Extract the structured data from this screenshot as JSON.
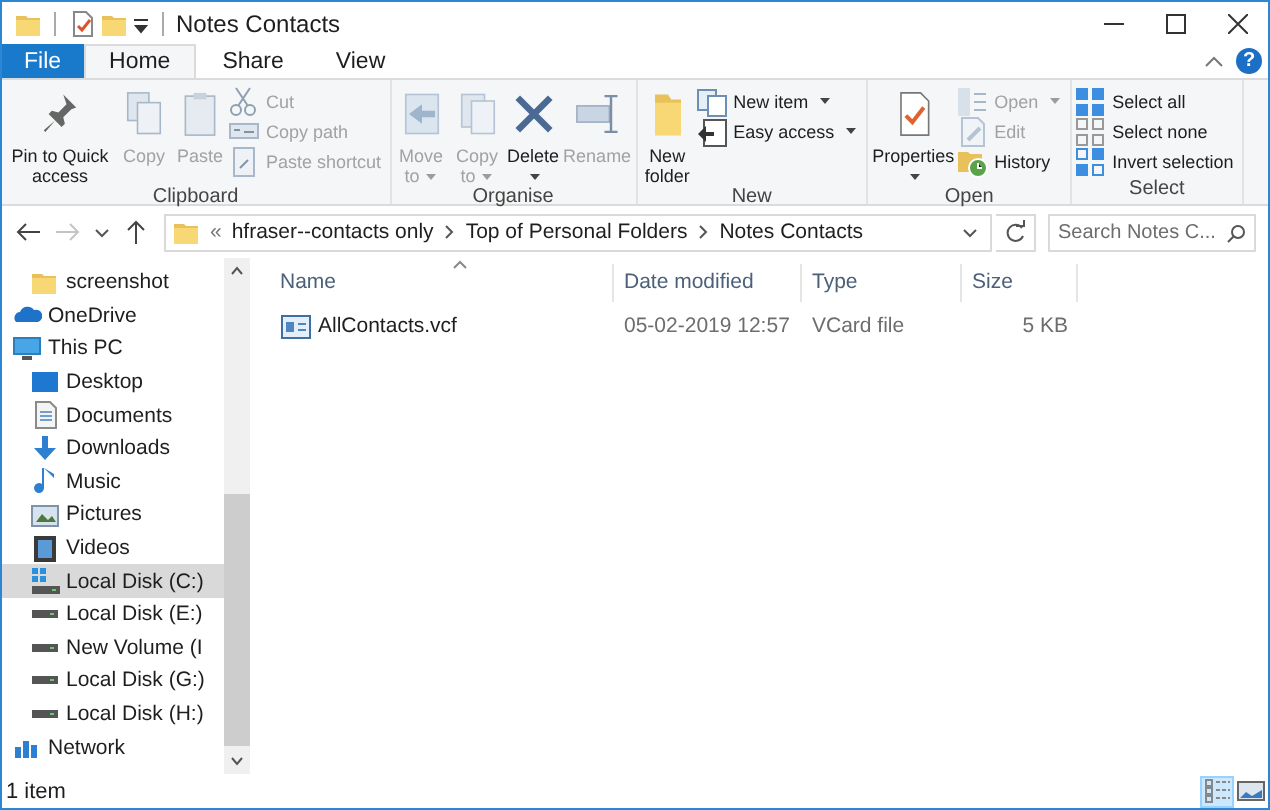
{
  "window": {
    "title": "Notes Contacts"
  },
  "tabs": [
    {
      "label": "File",
      "selected": false,
      "kind": "file"
    },
    {
      "label": "Home",
      "selected": true,
      "kind": "tab"
    },
    {
      "label": "Share",
      "selected": false,
      "kind": "tab"
    },
    {
      "label": "View",
      "selected": false,
      "kind": "tab"
    }
  ],
  "help_button": "?",
  "ribbon_groups": [
    {
      "label": "Clipboard",
      "commands": [
        {
          "kind": "large",
          "label": "Pin to Quick access",
          "disabled": false,
          "menu": false
        },
        {
          "kind": "large",
          "label": "Copy",
          "disabled": true,
          "menu": false
        },
        {
          "kind": "large",
          "label": "Paste",
          "disabled": true,
          "menu": false
        },
        {
          "kind": "stack",
          "items": [
            {
              "label": "Cut",
              "disabled": true,
              "menu": false
            },
            {
              "label": "Copy path",
              "disabled": true,
              "menu": false
            },
            {
              "label": "Paste shortcut",
              "disabled": true,
              "menu": false
            }
          ]
        }
      ]
    },
    {
      "label": "Organise",
      "commands": [
        {
          "kind": "large",
          "label": "Move to",
          "disabled": true,
          "menu": true
        },
        {
          "kind": "large",
          "label": "Copy to",
          "disabled": true,
          "menu": true
        },
        {
          "kind": "large",
          "label": "Delete",
          "disabled": false,
          "menu": true
        },
        {
          "kind": "large",
          "label": "Rename",
          "disabled": true,
          "menu": false
        }
      ]
    },
    {
      "label": "New",
      "commands": [
        {
          "kind": "large",
          "label": "New folder",
          "disabled": false,
          "menu": false
        },
        {
          "kind": "stack",
          "items": [
            {
              "label": "New item",
              "disabled": false,
              "menu": true
            },
            {
              "label": "Easy access",
              "disabled": false,
              "menu": true
            }
          ]
        }
      ]
    },
    {
      "label": "Open",
      "commands": [
        {
          "kind": "large",
          "label": "Properties",
          "disabled": false,
          "menu": true
        },
        {
          "kind": "stack",
          "items": [
            {
              "label": "Open",
              "disabled": true,
              "menu": true
            },
            {
              "label": "Edit",
              "disabled": true,
              "menu": false
            },
            {
              "label": "History",
              "disabled": false,
              "menu": false
            }
          ]
        }
      ]
    },
    {
      "label": "Select",
      "commands": [
        {
          "kind": "stack",
          "items": [
            {
              "label": "Select all",
              "disabled": false,
              "menu": false
            },
            {
              "label": "Select none",
              "disabled": false,
              "menu": false
            },
            {
              "label": "Invert selection",
              "disabled": false,
              "menu": false
            }
          ]
        }
      ]
    }
  ],
  "navigation": {
    "back_disabled": false,
    "forward_disabled": true
  },
  "address": {
    "overflow": "«",
    "crumbs": [
      "hfraser--contacts only",
      "Top of Personal Folders",
      "Notes Contacts"
    ]
  },
  "search": {
    "placeholder": "Search Notes C..."
  },
  "sidebar": {
    "items": [
      {
        "label": "screenshot",
        "selected": false
      },
      {
        "label": "OneDrive",
        "selected": false
      },
      {
        "label": "This PC",
        "selected": false,
        "children": [
          {
            "label": "Desktop",
            "selected": false
          },
          {
            "label": "Documents",
            "selected": false
          },
          {
            "label": "Downloads",
            "selected": false
          },
          {
            "label": "Music",
            "selected": false
          },
          {
            "label": "Pictures",
            "selected": false
          },
          {
            "label": "Videos",
            "selected": false
          },
          {
            "label": "Local Disk (C:)",
            "selected": true
          },
          {
            "label": "Local Disk (E:)",
            "selected": false
          },
          {
            "label": "New Volume (I",
            "selected": false
          },
          {
            "label": "Local Disk (G:)",
            "selected": false
          },
          {
            "label": "Local Disk (H:)",
            "selected": false
          }
        ]
      },
      {
        "label": "Network",
        "selected": false
      }
    ]
  },
  "table": {
    "columns": [
      "Name",
      "Date modified",
      "Type",
      "Size"
    ],
    "rows": [
      {
        "selected": false,
        "cells": [
          "AllContacts.vcf",
          "05-02-2019 12:57",
          "VCard file",
          "5 KB"
        ]
      }
    ]
  },
  "status_bar": {
    "text": "1 item"
  },
  "view_buttons": [
    {
      "kind": "details",
      "selected": true
    },
    {
      "kind": "thumbnails",
      "selected": false
    }
  ]
}
